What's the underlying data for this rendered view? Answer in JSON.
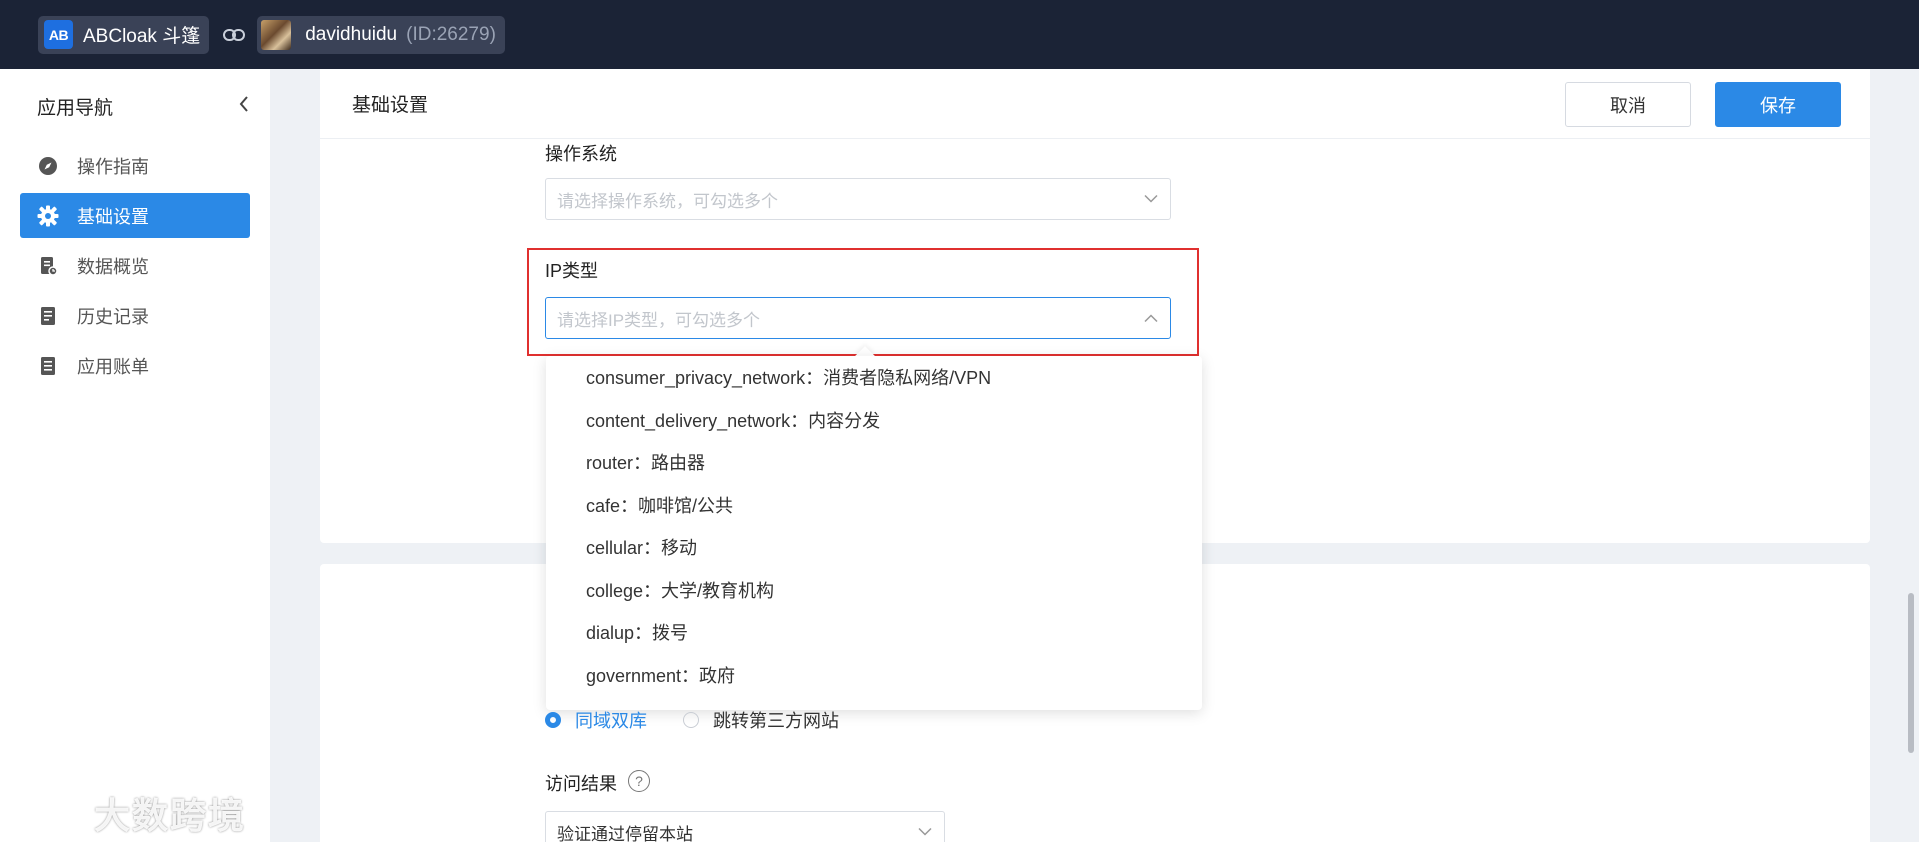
{
  "topbar": {
    "app_logo": "AB",
    "app_name": "ABCloak 斗篷",
    "user_name": "davidhuidu",
    "user_id": "(ID:26279)"
  },
  "sidebar": {
    "title": "应用导航",
    "items": [
      {
        "label": "操作指南",
        "icon": "compass-icon",
        "active": false
      },
      {
        "label": "基础设置",
        "icon": "gear-icon",
        "active": true
      },
      {
        "label": "数据概览",
        "icon": "report-icon",
        "active": false
      },
      {
        "label": "历史记录",
        "icon": "history-icon",
        "active": false
      },
      {
        "label": "应用账单",
        "icon": "bill-icon",
        "active": false
      }
    ]
  },
  "header": {
    "title": "基础设置",
    "cancel_label": "取消",
    "save_label": "保存"
  },
  "form": {
    "os": {
      "label": "操作系统",
      "placeholder": "请选择操作系统，可勾选多个"
    },
    "ip_type": {
      "label": "IP类型",
      "placeholder": "请选择IP类型，可勾选多个",
      "options": [
        "consumer_privacy_network：消费者隐私网络/VPN",
        "content_delivery_network：内容分发",
        "router：路由器",
        "cafe：咖啡馆/公共",
        "cellular：移动",
        "college：大学/教育机构",
        "dialup：拨号",
        "government：政府"
      ]
    },
    "mode": {
      "option_1": "同域双库",
      "option_2": "跳转第三方网站",
      "selected": "同域双库"
    },
    "access_result": {
      "label": "访问结果",
      "help": "?",
      "value": "验证通过停留本站"
    }
  },
  "watermark": {
    "text": "大数跨境"
  },
  "colors": {
    "topbar": "#1b2336",
    "primary": "#2b89e6",
    "highlight": "#e0302f"
  }
}
